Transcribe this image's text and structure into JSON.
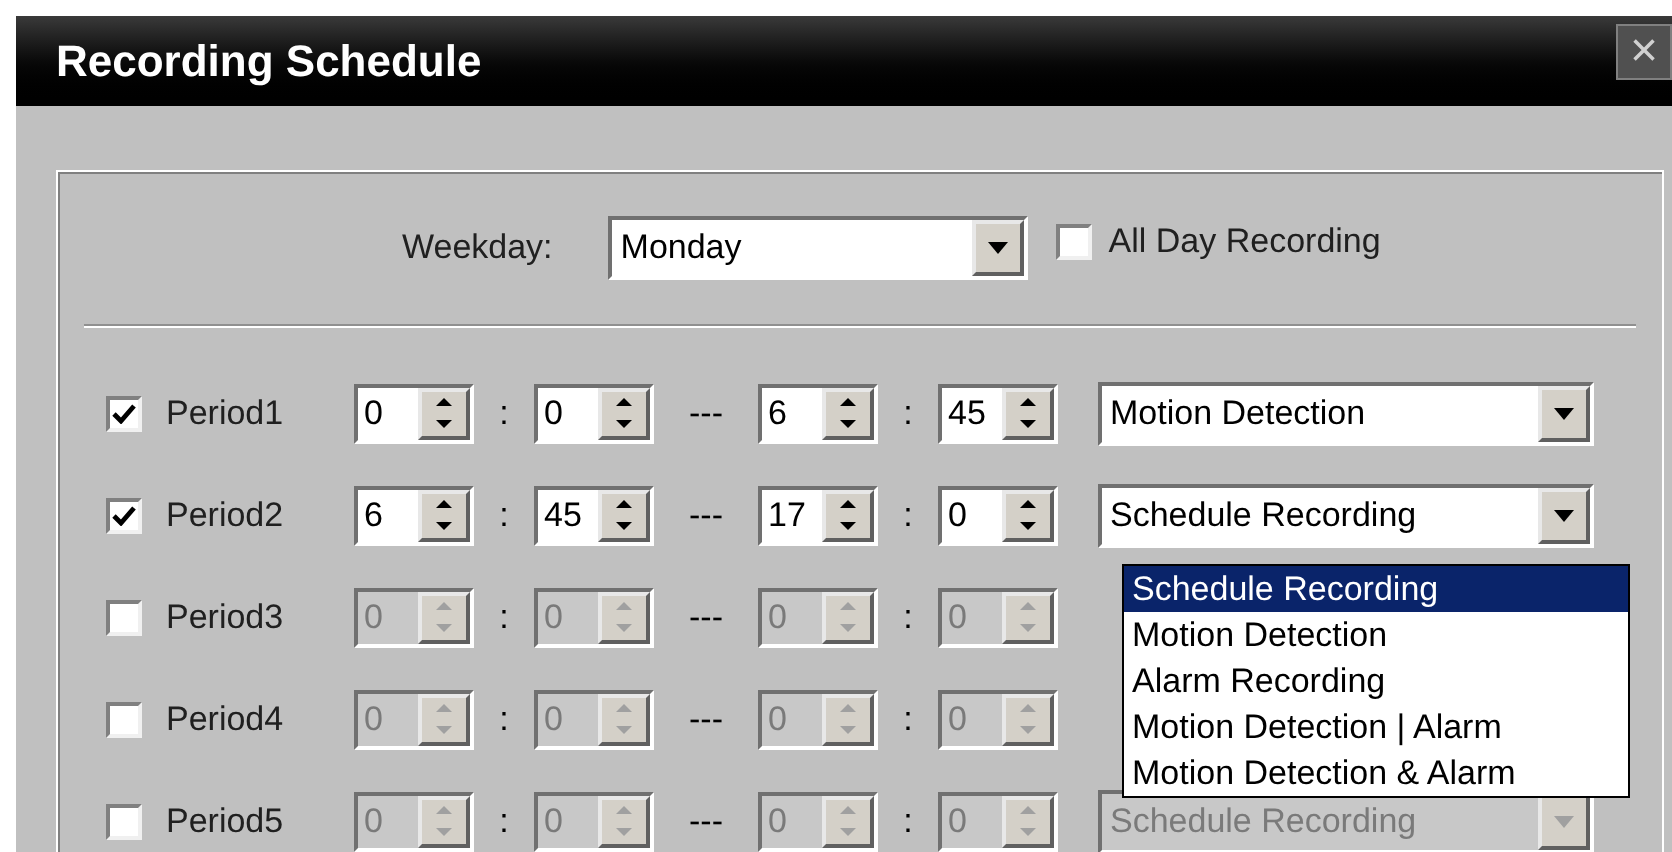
{
  "window": {
    "title": "Recording Schedule",
    "close": "×"
  },
  "weekday": {
    "label": "Weekday:",
    "value": "Monday"
  },
  "all_day": {
    "label": "All Day Recording",
    "checked": false
  },
  "periods": [
    {
      "label": "Period1",
      "checked": true,
      "start_hour": "0",
      "colon_1": ":",
      "start_minute": "0",
      "dash": "---",
      "end_hour": "6",
      "colon_2": ":",
      "end_minute": "45",
      "mode": "Motion Detection"
    },
    {
      "label": "Period2",
      "checked": true,
      "start_hour": "6",
      "colon_1": ":",
      "start_minute": "45",
      "dash": "---",
      "end_hour": "17",
      "colon_2": ":",
      "end_minute": "0",
      "mode": "Schedule Recording",
      "expanded": true
    },
    {
      "label": "Period3",
      "checked": false,
      "start_hour": "0",
      "colon_1": ":",
      "start_minute": "0",
      "dash": "---",
      "end_hour": "0",
      "colon_2": ":",
      "end_minute": "0"
    },
    {
      "label": "Period4",
      "checked": false,
      "start_hour": "0",
      "colon_1": ":",
      "start_minute": "0",
      "dash": "---",
      "end_hour": "0",
      "colon_2": ":",
      "end_minute": "0"
    },
    {
      "label": "Period5",
      "checked": false,
      "start_hour": "0",
      "colon_1": ":",
      "start_minute": "0",
      "dash": "---",
      "end_hour": "0",
      "colon_2": ":",
      "end_minute": "0",
      "mode": "Schedule Recording"
    }
  ],
  "mode_options": [
    {
      "label": "Schedule Recording",
      "selected": true
    },
    {
      "label": "Motion Detection",
      "selected": false
    },
    {
      "label": "Alarm Recording",
      "selected": false
    },
    {
      "label": "Motion Detection | Alarm",
      "selected": false
    },
    {
      "label": "Motion Detection & Alarm",
      "selected": false
    }
  ]
}
